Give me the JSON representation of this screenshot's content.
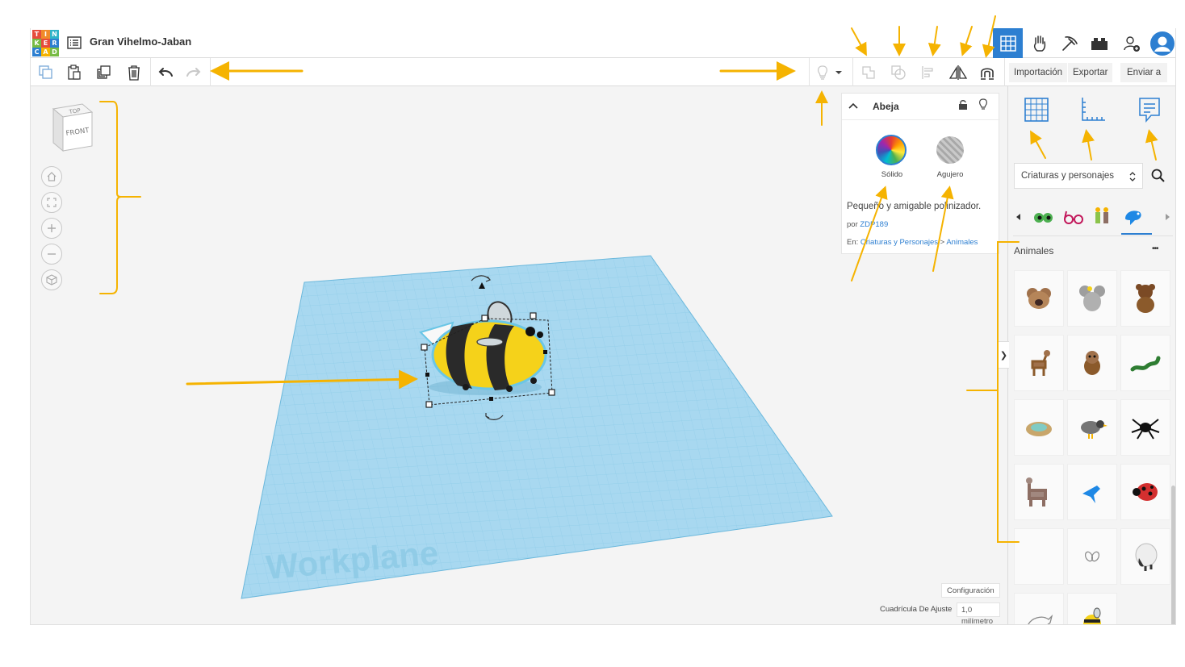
{
  "app": {
    "logo_letters": [
      "T",
      "I",
      "N",
      "K",
      "E",
      "R",
      "C",
      "A",
      "D"
    ],
    "design_title": "Gran Vihelmo-Jaban"
  },
  "topnav": {
    "items": [
      {
        "name": "3d-design-nav",
        "icon": "grid-icon",
        "active": true
      },
      {
        "name": "circuits-nav",
        "icon": "hand-icon",
        "active": false
      },
      {
        "name": "codeblocks-nav",
        "icon": "pickaxe-icon",
        "active": false
      },
      {
        "name": "bricks-nav",
        "icon": "brick-icon",
        "active": false
      },
      {
        "name": "invite-nav",
        "icon": "add-user-icon",
        "active": false
      },
      {
        "name": "profile-nav",
        "icon": "avatar-icon",
        "active": false
      }
    ]
  },
  "toolbar": {
    "left_tools": [
      "copy-icon",
      "paste-icon",
      "duplicate-icon",
      "trash-icon",
      "undo-icon",
      "redo-icon"
    ],
    "right_tools": [
      "lightbulb-icon",
      "dropdown-icon",
      "group-icon",
      "ungroup-icon",
      "align-icon",
      "mirror-icon",
      "magnet-icon"
    ],
    "import_label": "Importación",
    "export_label": "Exportar",
    "send_label": "Enviar a"
  },
  "viewcube": {
    "top_label": "TOP",
    "front_label": "FRONT"
  },
  "workplane": {
    "label": "Workplane"
  },
  "props": {
    "title": "Abeja",
    "solid_label": "Sólido",
    "hole_label": "Agujero",
    "description": "Pequeño y amigable polinizador.",
    "by_prefix": "por",
    "author": "ZDP189",
    "in_prefix": "En:",
    "category": "Criaturas y Personajes",
    "separator": ">",
    "subcategory": "Animales"
  },
  "rightpanel": {
    "views": [
      "workplane-view-icon",
      "ruler-view-icon",
      "notes-view-icon"
    ],
    "dropdown_value": "Criaturas y personajes",
    "section_title": "Animales",
    "more_label": "•••",
    "collapse_label": "❯"
  },
  "bottom": {
    "settings_label": "Configuración",
    "snap_label": "Cuadrícula De Ajuste",
    "snap_value": "1,0",
    "snap_unit": "milímetro"
  },
  "colors": {
    "accent": "#2d7fd1",
    "nav_active": "#2d7fd1",
    "arrow": "#f5b301",
    "workplane": "#a8d8f0",
    "grid_line": "#7fc3e3"
  }
}
